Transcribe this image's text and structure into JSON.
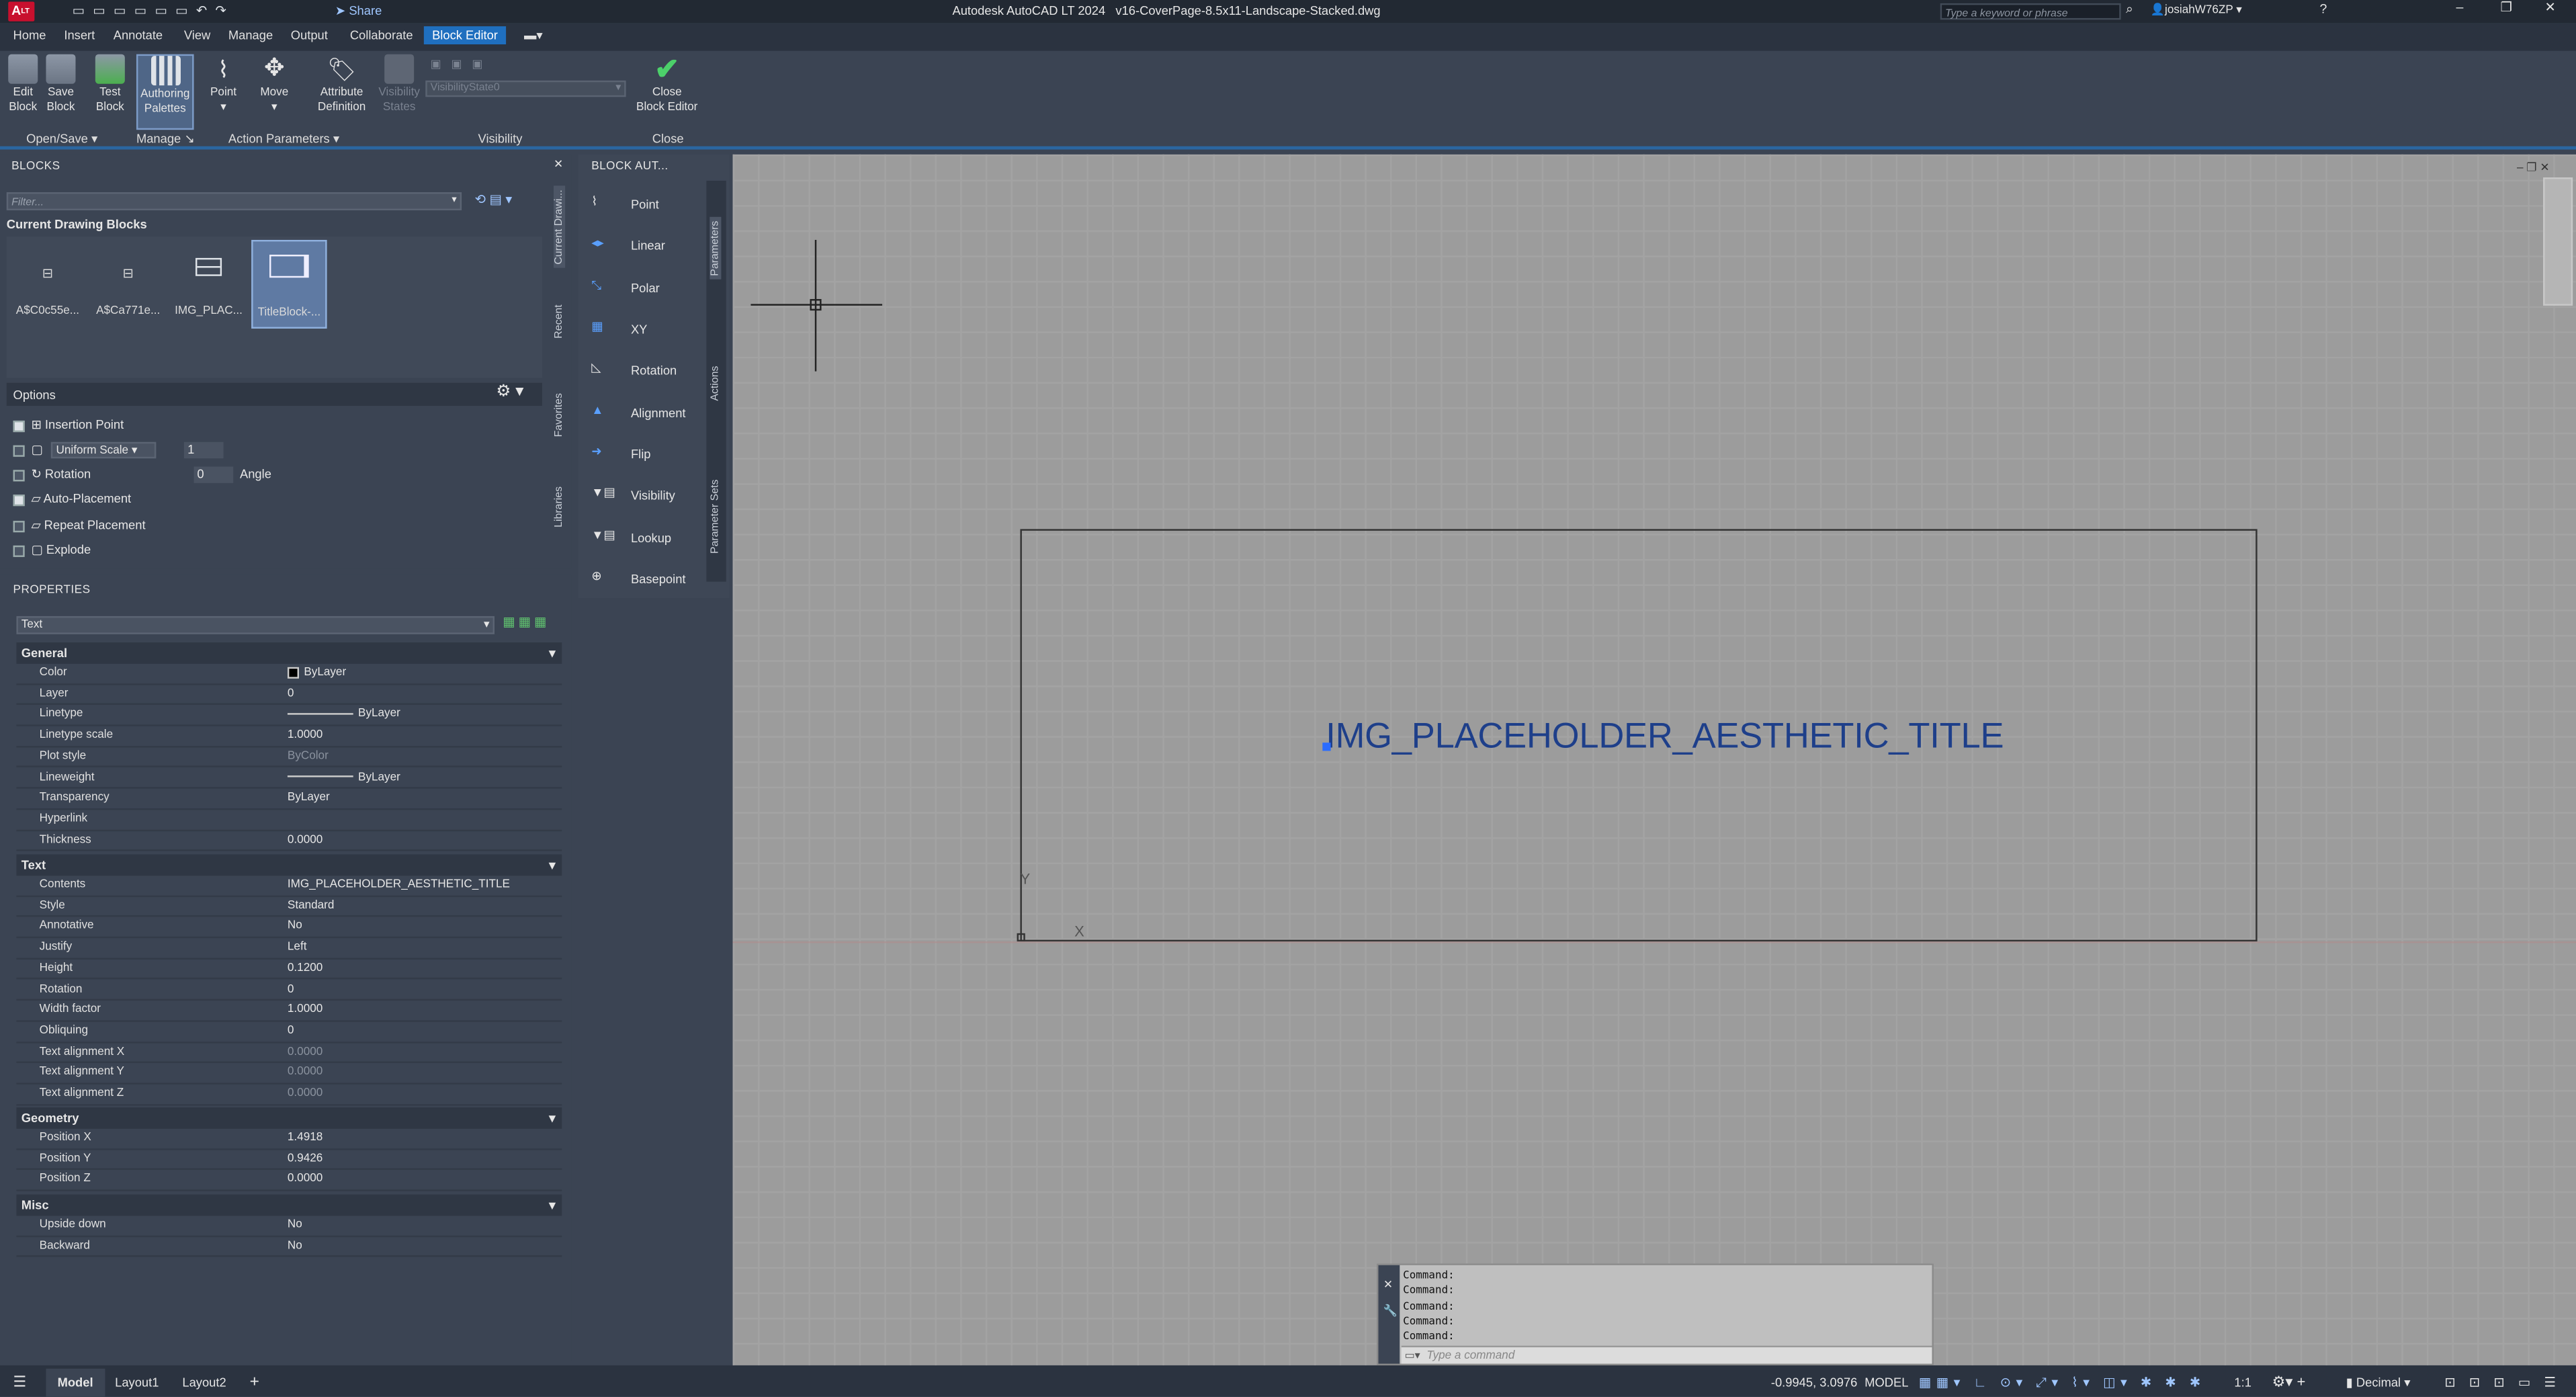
{
  "app": {
    "title": "Autodesk AutoCAD LT 2024   v16-CoverPage-8.5x11-Landscape-Stacked.dwg",
    "share": "Share",
    "search_placeholder": "Type a keyword or phrase",
    "user": "josiahW76ZP",
    "logo": "A",
    "logo_sub": "LT"
  },
  "menu": {
    "tabs": [
      "Home",
      "Insert",
      "Annotate",
      "View",
      "Manage",
      "Output",
      "Collaborate",
      "Block Editor"
    ],
    "active": "Block Editor"
  },
  "ribbon": {
    "buttons": [
      {
        "l1": "Edit",
        "l2": "Block"
      },
      {
        "l1": "Save",
        "l2": "Block"
      },
      {
        "l1": "Test",
        "l2": "Block"
      },
      {
        "l1": "Authoring",
        "l2": "Palettes"
      },
      {
        "l1": "Point",
        "l2": ""
      },
      {
        "l1": "Move",
        "l2": ""
      },
      {
        "l1": "Attribute",
        "l2": "Definition"
      },
      {
        "l1": "Visibility",
        "l2": "States"
      },
      {
        "l1": "Close",
        "l2": "Block Editor"
      }
    ],
    "visibility_state": "VisibilityState0",
    "groups": [
      "Open/Save",
      "Manage",
      "Action Parameters",
      "Visibility",
      "Close"
    ]
  },
  "blocks": {
    "header": "BLOCKS",
    "filter_placeholder": "Filter...",
    "section": "Current Drawing Blocks",
    "items": [
      "A$C0c55e...",
      "A$Ca771e...",
      "IMG_PLAC...",
      "TitleBlock-..."
    ],
    "side_tabs": [
      "Current Drawi...",
      "Recent",
      "Favorites",
      "Libraries"
    ],
    "options_header": "Options",
    "options": {
      "insertion_point": "Insertion Point",
      "uniform_scale": "Uniform Scale",
      "scale_value": "1",
      "rotation": "Rotation",
      "rotation_value": "0",
      "angle": "Angle",
      "auto_placement": "Auto-Placement",
      "repeat_placement": "Repeat Placement",
      "explode": "Explode"
    }
  },
  "authoring": {
    "header": "BLOCK AUT...",
    "tools": [
      "Point",
      "Linear",
      "Polar",
      "XY",
      "Rotation",
      "Alignment",
      "Flip",
      "Visibility",
      "Lookup",
      "Basepoint"
    ],
    "side_tabs": [
      "Parameters",
      "Actions",
      "Parameter Sets"
    ]
  },
  "properties": {
    "header": "PROPERTIES",
    "selected": "Text",
    "general_title": "General",
    "general": [
      [
        "Color",
        "ByLayer"
      ],
      [
        "Layer",
        "0"
      ],
      [
        "Linetype",
        "ByLayer"
      ],
      [
        "Linetype scale",
        "1.0000"
      ],
      [
        "Plot style",
        "ByColor"
      ],
      [
        "Lineweight",
        "ByLayer"
      ],
      [
        "Transparency",
        "ByLayer"
      ],
      [
        "Hyperlink",
        ""
      ],
      [
        "Thickness",
        "0.0000"
      ]
    ],
    "text_title": "Text",
    "text": [
      [
        "Contents",
        "IMG_PLACEHOLDER_AESTHETIC_TITLE"
      ],
      [
        "Style",
        "Standard"
      ],
      [
        "Annotative",
        "No"
      ],
      [
        "Justify",
        "Left"
      ],
      [
        "Height",
        "0.1200"
      ],
      [
        "Rotation",
        "0"
      ],
      [
        "Width factor",
        "1.0000"
      ],
      [
        "Obliquing",
        "0"
      ],
      [
        "Text alignment X",
        "0.0000"
      ],
      [
        "Text alignment Y",
        "0.0000"
      ],
      [
        "Text alignment Z",
        "0.0000"
      ]
    ],
    "geometry_title": "Geometry",
    "geometry": [
      [
        "Position X",
        "1.4918"
      ],
      [
        "Position Y",
        "0.9426"
      ],
      [
        "Position Z",
        "0.0000"
      ]
    ],
    "misc_title": "Misc",
    "misc": [
      [
        "Upside down",
        "No"
      ],
      [
        "Backward",
        "No"
      ]
    ]
  },
  "canvas": {
    "text": "IMG_PLACEHOLDER_AESTHETIC_TITLE",
    "axis_x": "X",
    "axis_y": "Y"
  },
  "command": {
    "history": [
      "Command:",
      "Command:",
      "Command:",
      "Command:",
      "Command:"
    ],
    "placeholder": "Type a command"
  },
  "status": {
    "tabs": [
      "Model",
      "Layout1",
      "Layout2"
    ],
    "coords": "-0.9945, 3.0976",
    "mode": "MODEL",
    "scale": "1:1",
    "units": "Decimal"
  },
  "colors": {
    "accent": "#1f6fbf",
    "canvas": "#9c9c9c",
    "text_blue": "#1e3f8a"
  }
}
